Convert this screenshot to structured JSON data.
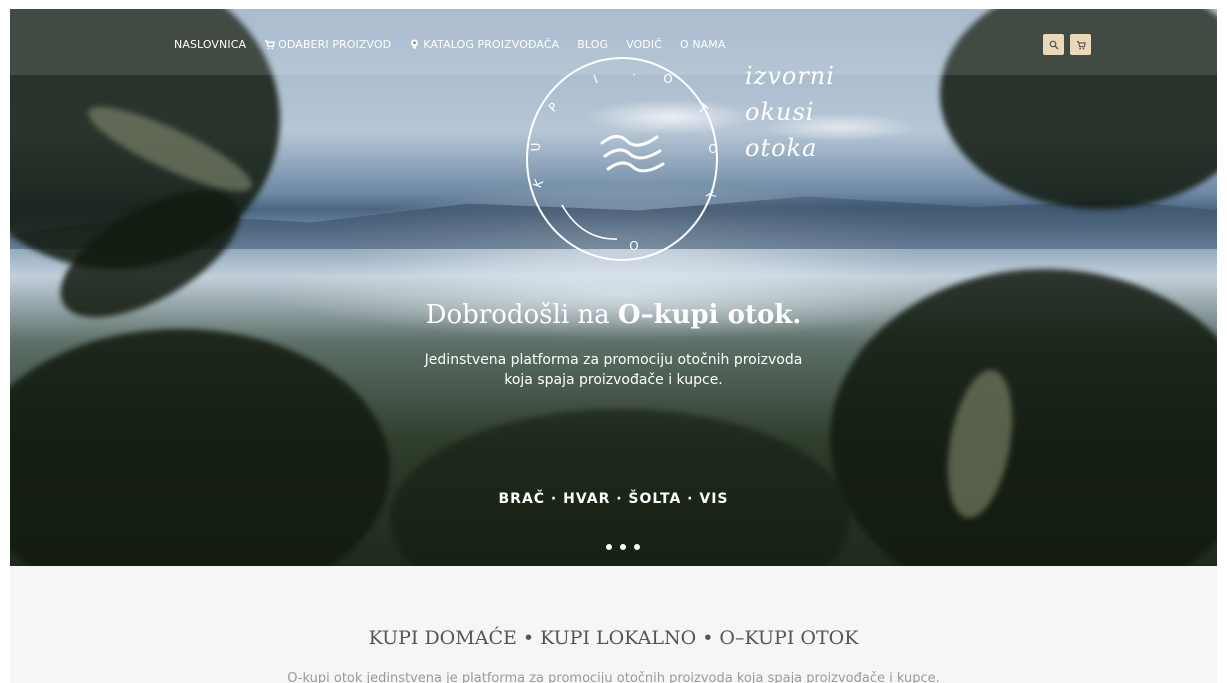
{
  "nav": {
    "items": [
      {
        "label": "NASLOVNICA",
        "icon": ""
      },
      {
        "label": "ODABERI PROIZVOD",
        "icon": "cart-icon"
      },
      {
        "label": "KATALOG PROIZVOĐAČA",
        "icon": "map-pin-icon"
      },
      {
        "label": "BLOG",
        "icon": ""
      },
      {
        "label": "VODIČ",
        "icon": ""
      },
      {
        "label": "O NAMA",
        "icon": ""
      }
    ],
    "buttons": [
      "search-icon",
      "cart-icon"
    ],
    "button_color": "#ead8b9"
  },
  "logo": {
    "ring_letters": [
      "K",
      "U",
      "P",
      "I",
      "·",
      "O",
      "T",
      "O",
      "K",
      "O"
    ],
    "tagline": [
      "izvorni",
      "okusi",
      "otoka"
    ]
  },
  "hero": {
    "title_regular": "Dobrodošli na ",
    "title_bold": "O–kupi otok.",
    "subtitle_line1": "Jedinstvena platforma za promociju otočnih proizvoda",
    "subtitle_line2": "koja spaja proizvođače i kupce.",
    "islands": "BRAČ · HVAR · ŠOLTA · VIS",
    "slides": 3
  },
  "section": {
    "title": "KUPI DOMAĆE • KUPI LOKALNO • O–KUPI OTOK",
    "text": "O-kupi otok jedinstvena je platforma za promociju otočnih proizvoda koja spaja proizvođače i kupce."
  }
}
